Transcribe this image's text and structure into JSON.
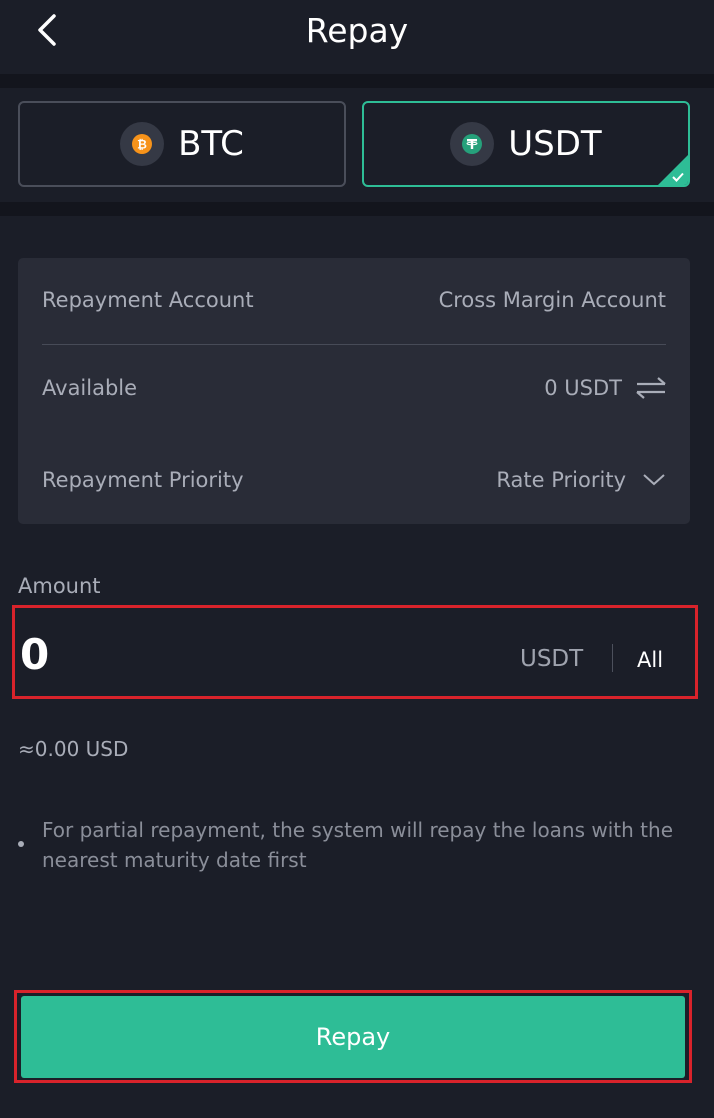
{
  "header": {
    "title": "Repay",
    "back_icon": "chevron-left-icon"
  },
  "coins": [
    {
      "label": "BTC",
      "icon": "bitcoin-icon",
      "color": "#f7931a",
      "selected": false
    },
    {
      "label": "USDT",
      "icon": "tether-icon",
      "color": "#26a17b",
      "selected": true
    }
  ],
  "info": {
    "account_label": "Repayment Account",
    "account_value": "Cross Margin Account",
    "available_label": "Available",
    "available_value": "0 USDT",
    "priority_label": "Repayment Priority",
    "priority_value": "Rate Priority"
  },
  "amount": {
    "label": "Amount",
    "value": "0",
    "unit": "USDT",
    "all_label": "All",
    "estimate": "≈0.00 USD"
  },
  "note": "For partial repayment, the system will repay the loans with the nearest maturity date first",
  "repay_button": "Repay",
  "colors": {
    "accent": "#2ebd96",
    "highlight": "#d9232b",
    "background": "#1b1e28",
    "card": "#292c37"
  }
}
